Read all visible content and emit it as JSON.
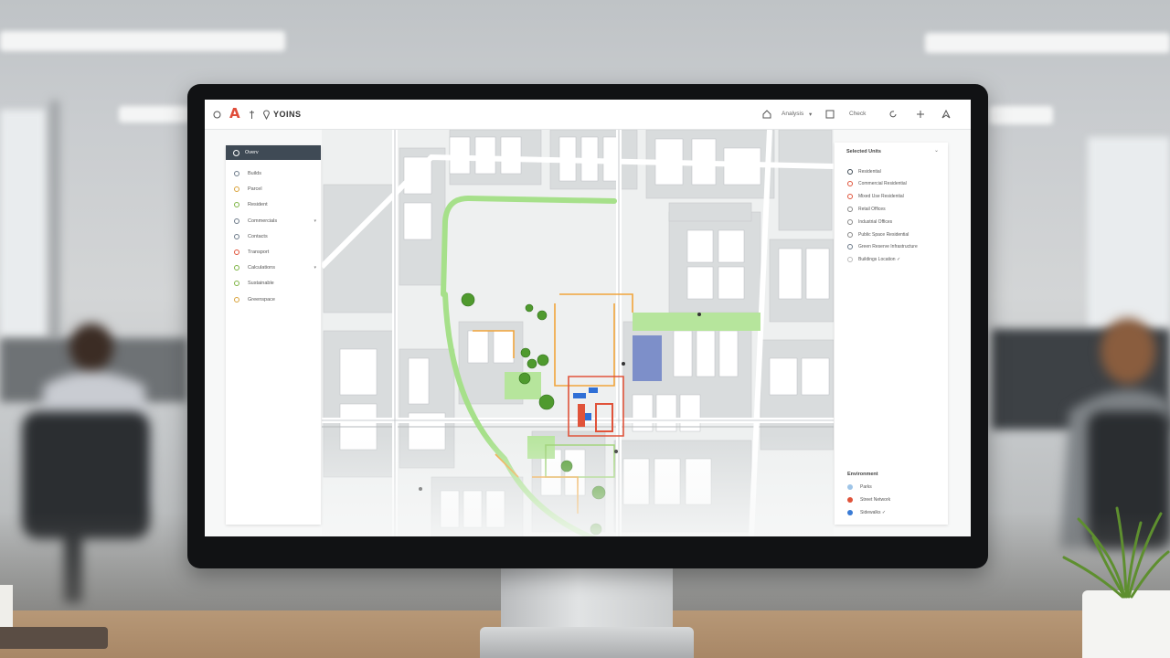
{
  "app": {
    "logo": "A",
    "title": "YOINS",
    "topbar": {
      "menu_label": "Analysis",
      "check_label": "Check",
      "icons": [
        "circle-icon",
        "pin-icon",
        "location-icon",
        "home-icon",
        "refresh-icon",
        "plus-icon",
        "navigate-icon"
      ]
    }
  },
  "left_panel": {
    "header": "Overv",
    "items": [
      {
        "label": "Builds",
        "icon_color": "#6c7a89",
        "has_chevron": false
      },
      {
        "label": "Parcel",
        "icon_color": "#d9a23a",
        "has_chevron": false
      },
      {
        "label": "Resident",
        "icon_color": "#7cb342",
        "has_chevron": false
      },
      {
        "label": "Commercials",
        "icon_color": "#6c7a89",
        "has_chevron": true
      },
      {
        "label": "Contacts",
        "icon_color": "#6c7a89",
        "has_chevron": false
      },
      {
        "label": "Transport",
        "icon_color": "#e0533a",
        "has_chevron": false
      },
      {
        "label": "Calculations",
        "icon_color": "#7cb342",
        "has_chevron": true
      },
      {
        "label": "Sustainable",
        "icon_color": "#7cb342",
        "has_chevron": false
      },
      {
        "label": "Greenspace",
        "icon_color": "#d9a23a",
        "has_chevron": false
      }
    ]
  },
  "right_panel": {
    "title": "Selected Units",
    "close": "⌄",
    "items": [
      {
        "label": "Residential",
        "icon_color": "#3f4a55"
      },
      {
        "label": "Commercial Residential",
        "icon_color": "#e0533a"
      },
      {
        "label": "Mixed Use Residential",
        "icon_color": "#e0533a"
      },
      {
        "label": "Retail Offices",
        "icon_color": "#888888"
      },
      {
        "label": "Industrial Offices",
        "icon_color": "#888888"
      },
      {
        "label": "Public Space Residential",
        "icon_color": "#888888"
      },
      {
        "label": "Green Reserve Infrastructure",
        "icon_color": "#6c7a89"
      },
      {
        "label": "Buildings Location  ✓",
        "icon_color": "#bbbbbb"
      }
    ],
    "legend_title": "Environment",
    "legend": [
      {
        "label": "Parks",
        "color": "#9fc5e8"
      },
      {
        "label": "Street Network",
        "color": "#e0533a"
      },
      {
        "label": "Sidewalks ✓",
        "color": "#3a7bd5"
      }
    ]
  }
}
